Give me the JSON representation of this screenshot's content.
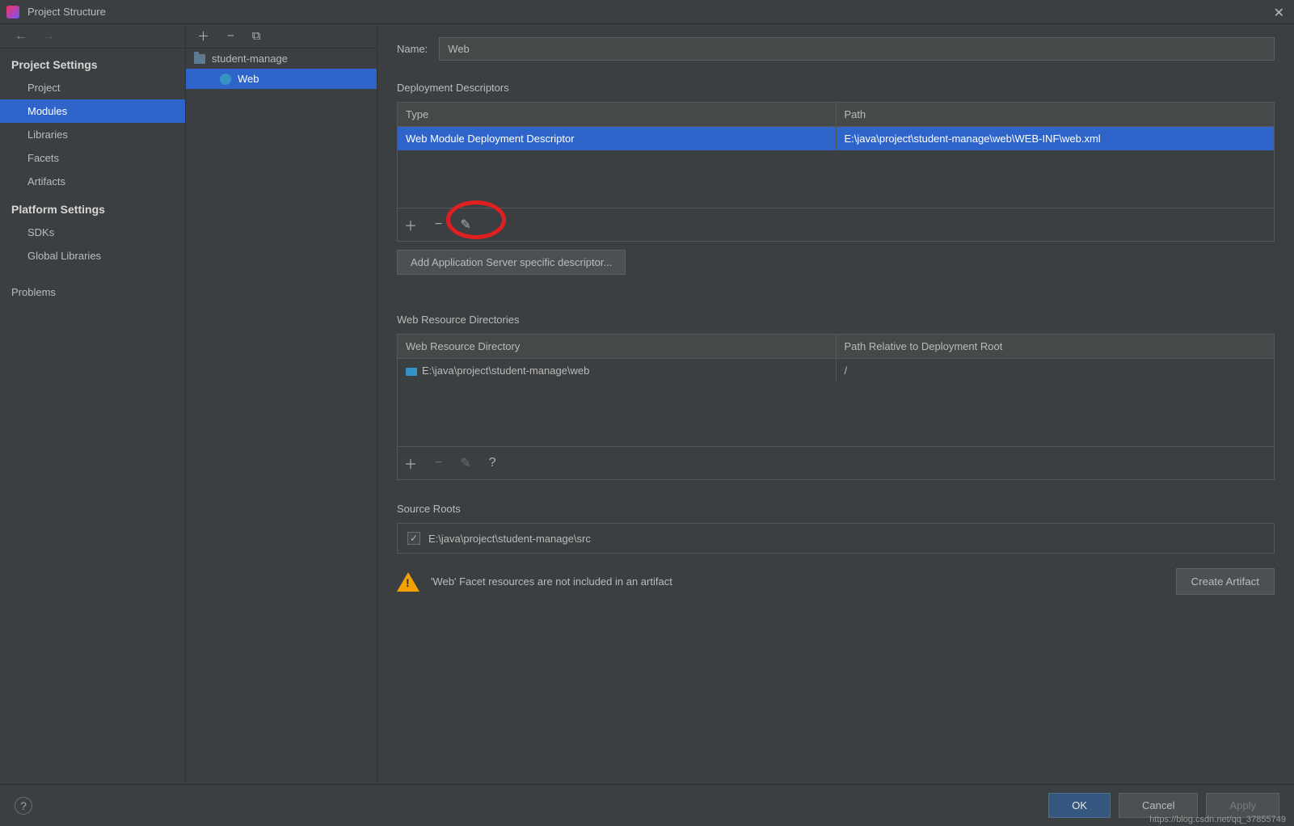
{
  "window": {
    "title": "Project Structure"
  },
  "sidebar": {
    "sections": [
      {
        "title": "Project Settings",
        "items": [
          {
            "label": "Project",
            "selected": false
          },
          {
            "label": "Modules",
            "selected": true
          },
          {
            "label": "Libraries",
            "selected": false
          },
          {
            "label": "Facets",
            "selected": false
          },
          {
            "label": "Artifacts",
            "selected": false
          }
        ]
      },
      {
        "title": "Platform Settings",
        "items": [
          {
            "label": "SDKs",
            "selected": false
          },
          {
            "label": "Global Libraries",
            "selected": false
          }
        ]
      }
    ],
    "extra_item": "Problems"
  },
  "tree": {
    "root": "student-manage",
    "child": "Web"
  },
  "form": {
    "name_label": "Name:",
    "name_value": "Web",
    "deployment_descriptors": {
      "title": "Deployment Descriptors",
      "columns": [
        "Type",
        "Path"
      ],
      "rows": [
        {
          "type": "Web Module Deployment Descriptor",
          "path": "E:\\java\\project\\student-manage\\web\\WEB-INF\\web.xml",
          "selected": true
        }
      ],
      "add_button": "Add Application Server specific descriptor..."
    },
    "web_resource_dirs": {
      "title": "Web Resource Directories",
      "columns": [
        "Web Resource Directory",
        "Path Relative to Deployment Root"
      ],
      "rows": [
        {
          "dir": "E:\\java\\project\\student-manage\\web",
          "rel": "/"
        }
      ]
    },
    "source_roots": {
      "title": "Source Roots",
      "items": [
        {
          "path": "E:\\java\\project\\student-manage\\src",
          "checked": true
        }
      ]
    },
    "warning": {
      "text": "'Web' Facet resources are not included in an artifact",
      "button": "Create Artifact"
    }
  },
  "buttons": {
    "ok": "OK",
    "cancel": "Cancel",
    "apply": "Apply"
  },
  "watermark": "https://blog.csdn.net/qq_37855749"
}
